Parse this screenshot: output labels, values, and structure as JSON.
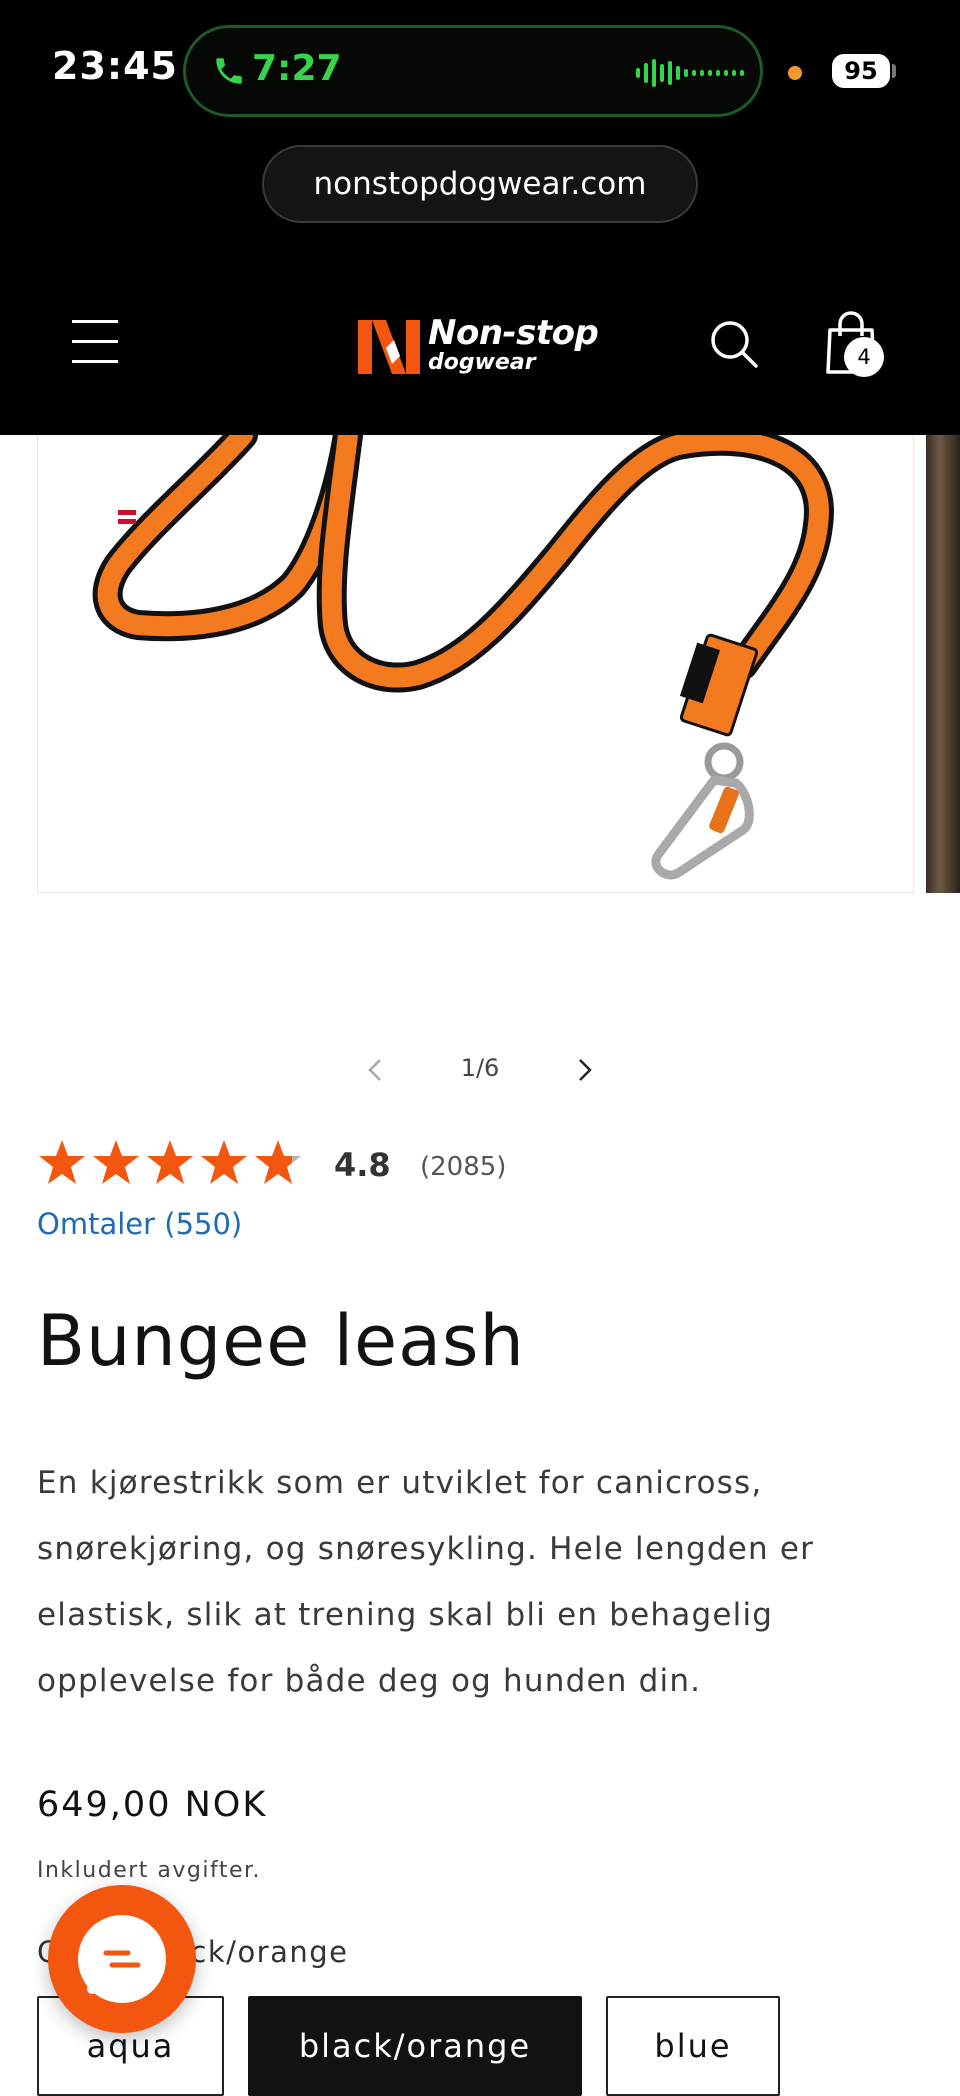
{
  "status_bar": {
    "time": "23:45",
    "call_duration": "7:27",
    "battery": "95"
  },
  "browser": {
    "url": "nonstopdogwear.com"
  },
  "header": {
    "logo_text_1": "Non-stop",
    "logo_text_2": "dogwear",
    "cart_count": "4"
  },
  "gallery": {
    "counter": "1/6",
    "current": 1,
    "total": 6
  },
  "product": {
    "rating_value": "4.8",
    "rating_stars": 4.8,
    "rating_count": "(2085)",
    "reviews_link": "Omtaler (550)",
    "title": "Bungee leash",
    "description": "En kjørestrikk som er utviklet for canicross, snørekjøring, og snøresykling. Hele lengden er elastisk, slik at trening skal bli en behagelig opplevelse for både deg og hunden din.",
    "price": "649,00 NOK",
    "tax_note": "Inkludert avgifter.",
    "variant_label": "Color: black/orange",
    "variants": [
      "aqua",
      "black/orange",
      "blue"
    ],
    "selected_variant": "black/orange"
  },
  "colors": {
    "brand_orange": "#f2560f",
    "link_blue": "#1f6bb5",
    "call_green": "#36d44a"
  }
}
